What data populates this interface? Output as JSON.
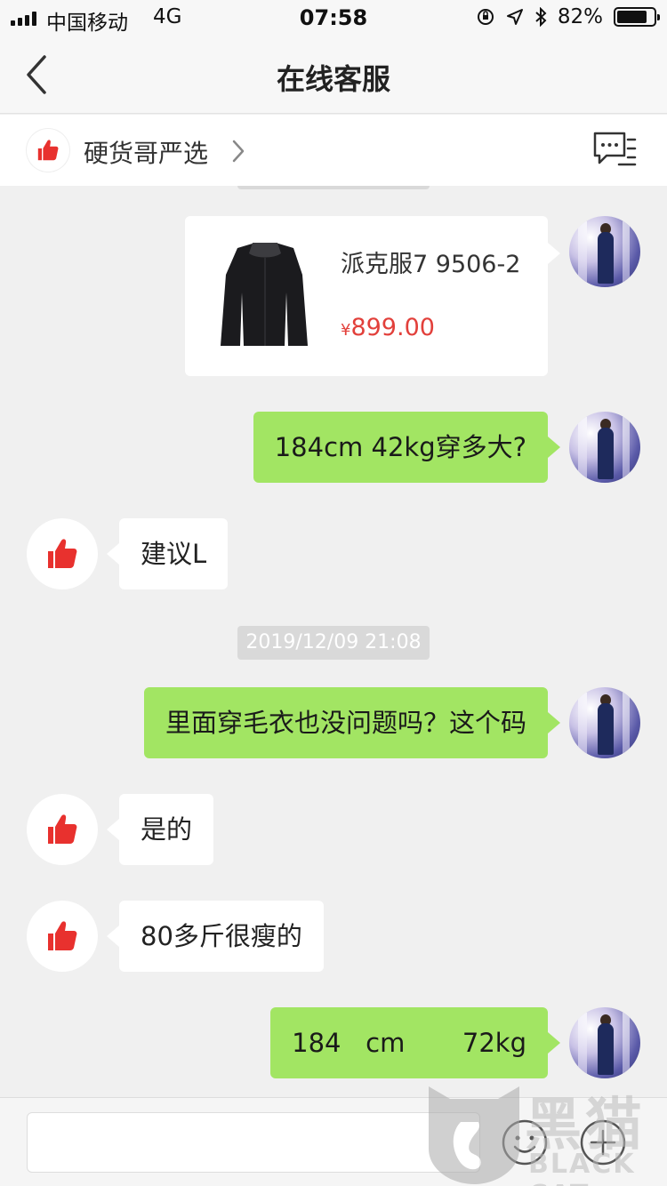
{
  "status_bar": {
    "carrier": "中国移动",
    "network": "4G",
    "time": "07:58",
    "battery_percent": "82%",
    "battery_level": 0.82
  },
  "nav": {
    "title": "在线客服"
  },
  "shop": {
    "name": "硬货哥严选"
  },
  "messages": [
    {
      "type": "product",
      "side": "out",
      "name": "派克服7 9506-2",
      "currency": "¥",
      "price": "899.00"
    },
    {
      "type": "text",
      "side": "out",
      "text": "184cm  42kg穿多大?"
    },
    {
      "type": "text",
      "side": "in",
      "text": "建议L"
    },
    {
      "type": "timestamp",
      "text": "2019/12/09 21:08"
    },
    {
      "type": "text",
      "side": "out",
      "text": "里面穿毛衣也没问题吗？这个码"
    },
    {
      "type": "text",
      "side": "in",
      "text": "是的"
    },
    {
      "type": "text",
      "side": "in",
      "text": "80多斤很瘦的"
    },
    {
      "type": "text",
      "side": "out",
      "text": "184   cm       72kg"
    }
  ],
  "input": {
    "value": "",
    "placeholder": ""
  },
  "watermark": {
    "cn": "黑猫",
    "en": "BLACK CAT"
  },
  "colors": {
    "outgoing_bubble": "#a2e563",
    "incoming_bubble": "#ffffff",
    "price": "#e2403b",
    "brand_red": "#e8312e"
  }
}
